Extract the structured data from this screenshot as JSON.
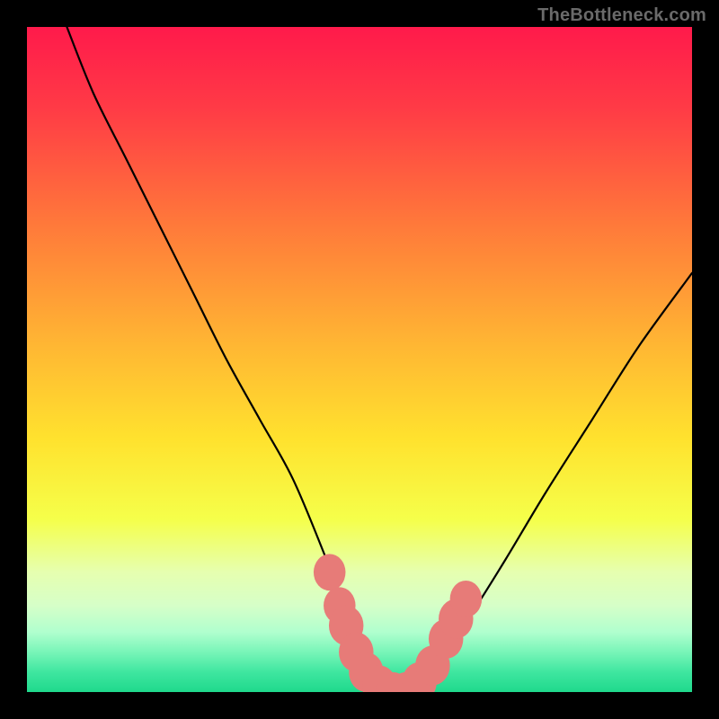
{
  "watermark": {
    "text": "TheBottleneck.com"
  },
  "colors": {
    "black": "#000000",
    "curve": "#000000",
    "marker": "#e77b78",
    "gradient_stops": [
      {
        "pct": 0,
        "color": "#ff1a4b"
      },
      {
        "pct": 12,
        "color": "#ff3a46"
      },
      {
        "pct": 30,
        "color": "#ff7a3a"
      },
      {
        "pct": 48,
        "color": "#ffb733"
      },
      {
        "pct": 62,
        "color": "#ffe22e"
      },
      {
        "pct": 74,
        "color": "#f5ff4a"
      },
      {
        "pct": 82,
        "color": "#e6ffb0"
      },
      {
        "pct": 87,
        "color": "#d6ffc8"
      },
      {
        "pct": 91,
        "color": "#b0ffce"
      },
      {
        "pct": 94,
        "color": "#78f5b8"
      },
      {
        "pct": 97,
        "color": "#3fe6a0"
      },
      {
        "pct": 100,
        "color": "#1fd98c"
      }
    ]
  },
  "chart_data": {
    "type": "line",
    "title": "",
    "xlabel": "",
    "ylabel": "",
    "xlim": [
      0,
      100
    ],
    "ylim": [
      0,
      100
    ],
    "series": [
      {
        "name": "bottleneck-curve",
        "x": [
          6,
          10,
          15,
          20,
          25,
          30,
          35,
          40,
          45,
          48,
          50,
          52,
          54,
          56,
          58,
          60,
          63,
          67,
          72,
          78,
          85,
          92,
          100
        ],
        "values": [
          100,
          90,
          80,
          70,
          60,
          50,
          41,
          32,
          20,
          12,
          6,
          2,
          0,
          0,
          0,
          2,
          6,
          12,
          20,
          30,
          41,
          52,
          63
        ]
      }
    ],
    "markers": [
      {
        "x": 45.5,
        "y": 18,
        "r": 2.4
      },
      {
        "x": 47.0,
        "y": 13,
        "r": 2.4
      },
      {
        "x": 48.0,
        "y": 10,
        "r": 2.6
      },
      {
        "x": 49.5,
        "y": 6,
        "r": 2.6
      },
      {
        "x": 51.0,
        "y": 3,
        "r": 2.6
      },
      {
        "x": 53.0,
        "y": 1,
        "r": 2.6
      },
      {
        "x": 55.0,
        "y": 0,
        "r": 2.6
      },
      {
        "x": 57.0,
        "y": 0,
        "r": 2.6
      },
      {
        "x": 59.0,
        "y": 1.5,
        "r": 2.6
      },
      {
        "x": 61.0,
        "y": 4,
        "r": 2.6
      },
      {
        "x": 63.0,
        "y": 8,
        "r": 2.6
      },
      {
        "x": 64.5,
        "y": 11,
        "r": 2.6
      },
      {
        "x": 66.0,
        "y": 14,
        "r": 2.4
      }
    ]
  }
}
